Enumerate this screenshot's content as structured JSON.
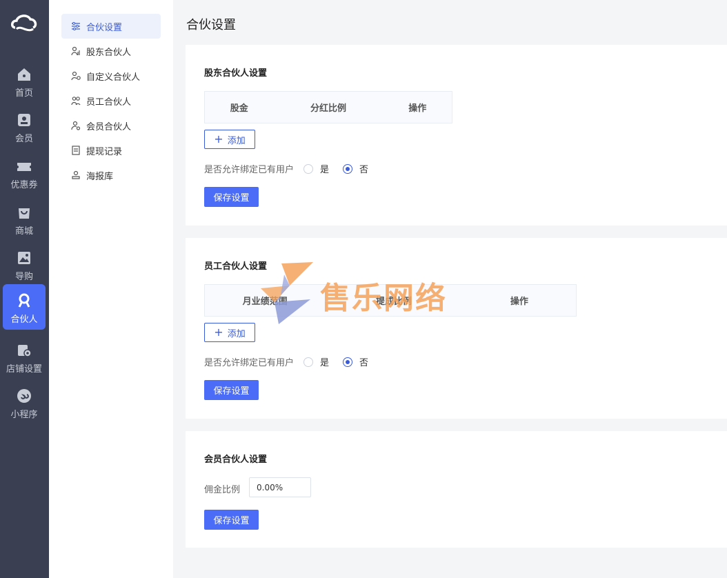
{
  "rail": {
    "items": [
      {
        "label": "首页",
        "icon": "home-icon"
      },
      {
        "label": "会员",
        "icon": "member-icon"
      },
      {
        "label": "优惠券",
        "icon": "coupon-icon"
      },
      {
        "label": "商城",
        "icon": "shop-bag-icon"
      },
      {
        "label": "导购",
        "icon": "image-icon"
      },
      {
        "label": "合伙人",
        "icon": "partner-icon",
        "active": true
      },
      {
        "label": "店铺设置",
        "icon": "store-settings-icon"
      },
      {
        "label": "小程序",
        "icon": "mini-program-icon"
      }
    ]
  },
  "subnav": {
    "items": [
      {
        "label": "合伙设置",
        "icon": "sliders-icon",
        "active": true
      },
      {
        "label": "股东合伙人",
        "icon": "shareholder-icon"
      },
      {
        "label": "自定义合伙人",
        "icon": "custom-partner-icon"
      },
      {
        "label": "员工合伙人",
        "icon": "employee-icon"
      },
      {
        "label": "会员合伙人",
        "icon": "member-partner-icon"
      },
      {
        "label": "提现记录",
        "icon": "record-icon"
      },
      {
        "label": "海报库",
        "icon": "poster-icon"
      }
    ]
  },
  "page_title": "合伙设置",
  "shareholder": {
    "title": "股东合伙人设置",
    "columns": [
      "股金",
      "分红比例",
      "操作"
    ],
    "add_label": "添加",
    "bind_question": "是否允许绑定已有用户",
    "yes_label": "是",
    "no_label": "否",
    "selected": "否",
    "save_label": "保存设置"
  },
  "employee": {
    "title": "员工合伙人设置",
    "columns": [
      "月业绩范围",
      "提成比例",
      "操作"
    ],
    "add_label": "添加",
    "bind_question": "是否允许绑定已有用户",
    "yes_label": "是",
    "no_label": "否",
    "selected": "否",
    "save_label": "保存设置"
  },
  "member": {
    "title": "会员合伙人设置",
    "commission_label": "佣金比例",
    "commission_value": "0.00%",
    "save_label": "保存设置"
  },
  "watermark": {
    "text": "售乐网络"
  },
  "colors": {
    "accent": "#4a6cf7",
    "rail_bg": "#3a3f51",
    "watermark": "#f5a35c"
  }
}
